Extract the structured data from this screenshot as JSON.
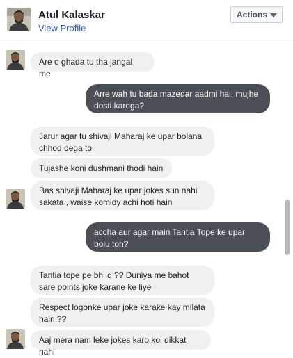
{
  "header": {
    "name": "Atul Kalaskar",
    "profile_link": "View Profile",
    "actions_label": "Actions"
  },
  "messages": [
    {
      "side": "in",
      "text": "Are o ghada tu tha jangal me"
    },
    {
      "side": "out",
      "text": "Arre wah tu bada mazedar aadmi hai, mujhe dosti karega?"
    },
    {
      "side": "in",
      "text": "Jarur agar tu shivaji Maharaj ke upar bolana chhod dega to"
    },
    {
      "side": "in",
      "text": "Tujashe koni dushmani thodi hain"
    },
    {
      "side": "in",
      "text": "Bas shivaji Maharaj ke upar jokes sun nahi sakata , waise komidy achi hoti hain"
    },
    {
      "side": "out",
      "text": "accha aur agar main Tantia Tope ke upar bolu toh?"
    },
    {
      "side": "in",
      "text": "Tantia tope pe bhi q ?? Duniya me bahot sare points joke karane ke liye"
    },
    {
      "side": "in",
      "text": "Respect logonke upar joke karake kay milata hain ??"
    },
    {
      "side": "in",
      "text": "Aaj mera nam leke jokes karo koi dikkat nahi"
    }
  ]
}
